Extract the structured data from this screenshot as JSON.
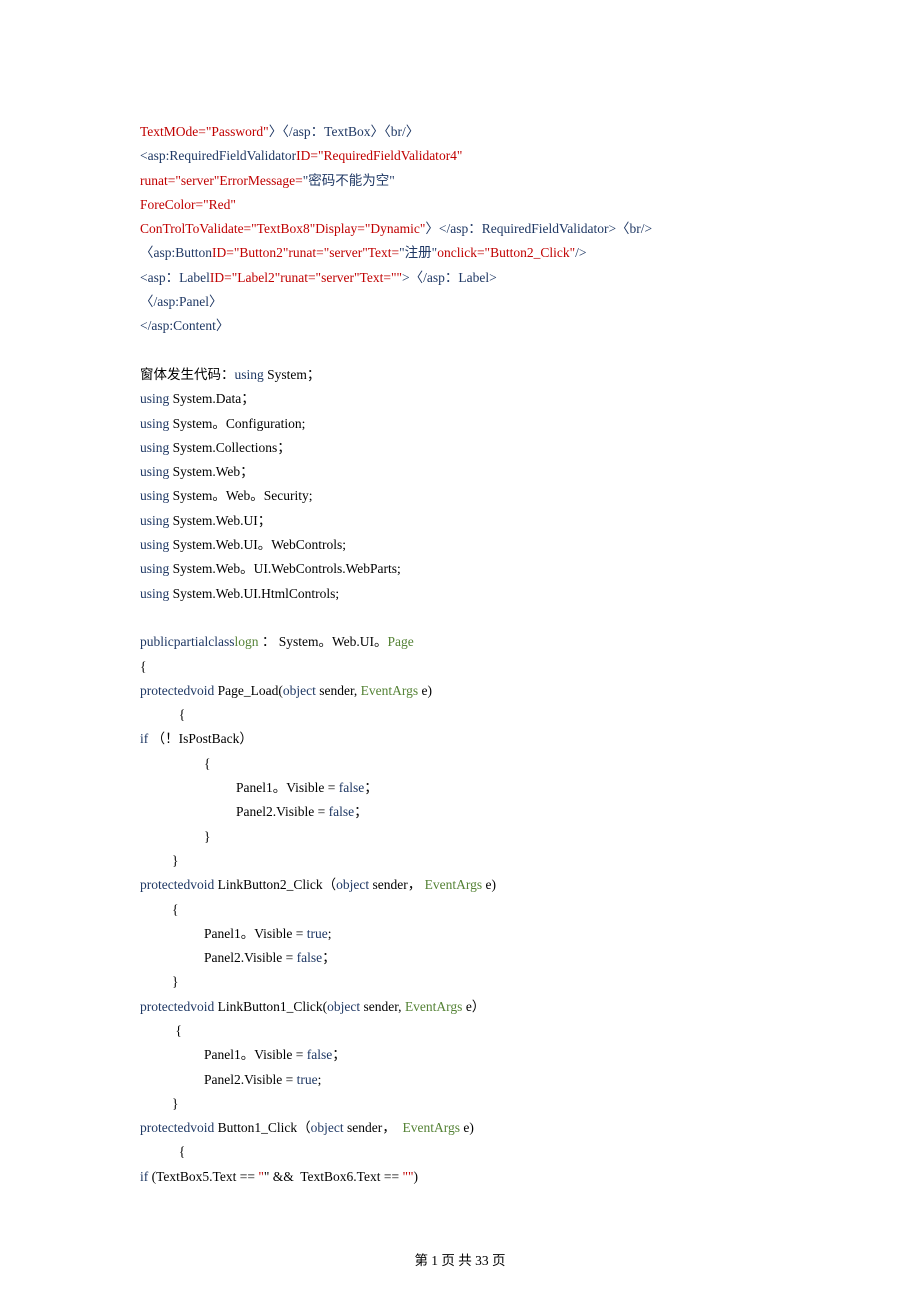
{
  "lines": [
    {
      "cls": "line",
      "segs": [
        {
          "c": "red",
          "t": "TextMOde=\"Password\""
        },
        {
          "c": "navy",
          "t": "〉〈/asp：TextBox〉〈br/〉"
        }
      ]
    },
    {
      "cls": "line",
      "segs": [
        {
          "c": "navy",
          "t": "<asp:RequiredFieldValidator"
        },
        {
          "c": "red",
          "t": "ID=\"RequiredFieldValidator4\""
        }
      ]
    },
    {
      "cls": "line",
      "segs": [
        {
          "c": "red",
          "t": "runat=\"server\""
        },
        {
          "c": "red",
          "t": "ErrorMessage="
        },
        {
          "c": "navy",
          "t": "\"密码不能为空\""
        }
      ]
    },
    {
      "cls": "line",
      "segs": [
        {
          "c": "red",
          "t": "ForeColor=\"Red\""
        }
      ]
    },
    {
      "cls": "line",
      "segs": [
        {
          "c": "red",
          "t": "ConTrolToValidate=\"TextBox8\"Display=\"Dynamic\""
        },
        {
          "c": "navy",
          "t": "〉</asp：RequiredFieldValidator>〈br/>"
        }
      ]
    },
    {
      "cls": "line",
      "segs": [
        {
          "c": "navy",
          "t": "〈asp:Button"
        },
        {
          "c": "red",
          "t": "ID=\"Button2\"runat=\"server\"Text="
        },
        {
          "c": "navy",
          "t": "\"注册\""
        },
        {
          "c": "red",
          "t": "onclick=\"Button2_Click\""
        },
        {
          "c": "navy",
          "t": "/>"
        }
      ]
    },
    {
      "cls": "line",
      "segs": [
        {
          "c": "navy",
          "t": "<asp：Label"
        },
        {
          "c": "red",
          "t": "ID=\"Label2\"runat=\"server\"Text=\"\""
        },
        {
          "c": "navy",
          "t": ">〈/asp：Label>"
        }
      ]
    },
    {
      "cls": "line",
      "segs": [
        {
          "c": "navy",
          "t": "〈/asp:Panel〉"
        }
      ]
    },
    {
      "cls": "line",
      "segs": [
        {
          "c": "navy",
          "t": "</asp:Content〉"
        }
      ]
    },
    {
      "cls": "line",
      "segs": [
        {
          "c": "black",
          "t": " "
        }
      ]
    },
    {
      "cls": "line",
      "segs": [
        {
          "c": "black",
          "t": "窗体发生代码："
        },
        {
          "c": "navy",
          "t": "using"
        },
        {
          "c": "black",
          "t": " System；"
        }
      ]
    },
    {
      "cls": "line",
      "segs": [
        {
          "c": "navy",
          "t": "using"
        },
        {
          "c": "black",
          "t": " System.Data；"
        }
      ]
    },
    {
      "cls": "line",
      "segs": [
        {
          "c": "navy",
          "t": "using"
        },
        {
          "c": "black",
          "t": " System。Configuration;"
        }
      ]
    },
    {
      "cls": "line",
      "segs": [
        {
          "c": "navy",
          "t": "using"
        },
        {
          "c": "black",
          "t": " System.Collections；"
        }
      ]
    },
    {
      "cls": "line",
      "segs": [
        {
          "c": "navy",
          "t": "using"
        },
        {
          "c": "black",
          "t": " System.Web；"
        }
      ]
    },
    {
      "cls": "line",
      "segs": [
        {
          "c": "navy",
          "t": "using"
        },
        {
          "c": "black",
          "t": " System。Web。Security;"
        }
      ]
    },
    {
      "cls": "line",
      "segs": [
        {
          "c": "navy",
          "t": "using"
        },
        {
          "c": "black",
          "t": " System.Web.UI；"
        }
      ]
    },
    {
      "cls": "line",
      "segs": [
        {
          "c": "navy",
          "t": "using"
        },
        {
          "c": "black",
          "t": " System.Web.UI。WebControls;"
        }
      ]
    },
    {
      "cls": "line",
      "segs": [
        {
          "c": "navy",
          "t": "using"
        },
        {
          "c": "black",
          "t": " System.Web。UI.WebControls.WebParts;"
        }
      ]
    },
    {
      "cls": "line",
      "segs": [
        {
          "c": "navy",
          "t": "using"
        },
        {
          "c": "black",
          "t": " System.Web.UI.HtmlControls;"
        }
      ]
    },
    {
      "cls": "line",
      "segs": [
        {
          "c": "black",
          "t": " "
        }
      ]
    },
    {
      "cls": "line",
      "segs": [
        {
          "c": "navy",
          "t": "publicpartialclass"
        },
        {
          "c": "green",
          "t": "logn"
        },
        {
          "c": "black",
          "t": " ： System。Web.UI。"
        },
        {
          "c": "green",
          "t": "Page"
        }
      ]
    },
    {
      "cls": "line",
      "segs": [
        {
          "c": "black",
          "t": "{"
        }
      ]
    },
    {
      "cls": "line",
      "segs": [
        {
          "c": "navy",
          "t": "protectedvoid"
        },
        {
          "c": "black",
          "t": " Page_Load("
        },
        {
          "c": "navy",
          "t": "object"
        },
        {
          "c": "black",
          "t": " sender, "
        },
        {
          "c": "green",
          "t": "EventArgs"
        },
        {
          "c": "black",
          "t": " e)"
        }
      ]
    },
    {
      "cls": "line ind1",
      "segs": [
        {
          "c": "black",
          "t": "  {"
        }
      ]
    },
    {
      "cls": "line",
      "segs": [
        {
          "c": "navy",
          "t": "if"
        },
        {
          "c": "black",
          "t": " （！IsPostBack）"
        }
      ]
    },
    {
      "cls": "line ind2",
      "segs": [
        {
          "c": "black",
          "t": "{"
        }
      ]
    },
    {
      "cls": "line ind3",
      "segs": [
        {
          "c": "black",
          "t": "Panel1。Visible = "
        },
        {
          "c": "navy",
          "t": "false"
        },
        {
          "c": "black",
          "t": "；"
        }
      ]
    },
    {
      "cls": "line ind3",
      "segs": [
        {
          "c": "black",
          "t": "Panel2.Visible = "
        },
        {
          "c": "navy",
          "t": "false"
        },
        {
          "c": "black",
          "t": "；"
        }
      ]
    },
    {
      "cls": "line ind2",
      "segs": [
        {
          "c": "black",
          "t": "}"
        }
      ]
    },
    {
      "cls": "line ind1",
      "segs": [
        {
          "c": "black",
          "t": "}"
        }
      ]
    },
    {
      "cls": "line",
      "segs": [
        {
          "c": "navy",
          "t": "protectedvoid"
        },
        {
          "c": "black",
          "t": " LinkButton2_Click（"
        },
        {
          "c": "navy",
          "t": "object"
        },
        {
          "c": "black",
          "t": " sender， "
        },
        {
          "c": "green",
          "t": "EventArgs"
        },
        {
          "c": "black",
          "t": " e)"
        }
      ]
    },
    {
      "cls": "line ind1",
      "segs": [
        {
          "c": "black",
          "t": "{"
        }
      ]
    },
    {
      "cls": "line ind2",
      "segs": [
        {
          "c": "black",
          "t": "Panel1。Visible = "
        },
        {
          "c": "navy",
          "t": "true"
        },
        {
          "c": "black",
          "t": ";"
        }
      ]
    },
    {
      "cls": "line ind2",
      "segs": [
        {
          "c": "black",
          "t": "Panel2.Visible = "
        },
        {
          "c": "navy",
          "t": "false"
        },
        {
          "c": "black",
          "t": "；"
        }
      ]
    },
    {
      "cls": "line ind1",
      "segs": [
        {
          "c": "black",
          "t": "}"
        }
      ]
    },
    {
      "cls": "line",
      "segs": [
        {
          "c": "navy",
          "t": "protectedvoid"
        },
        {
          "c": "black",
          "t": " LinkButton1_Click("
        },
        {
          "c": "navy",
          "t": "object"
        },
        {
          "c": "black",
          "t": " sender, "
        },
        {
          "c": "green",
          "t": "EventArgs"
        },
        {
          "c": "black",
          "t": " e）"
        }
      ]
    },
    {
      "cls": "line ind1",
      "segs": [
        {
          "c": "black",
          "t": " {"
        }
      ]
    },
    {
      "cls": "line ind2",
      "segs": [
        {
          "c": "black",
          "t": "Panel1。Visible = "
        },
        {
          "c": "navy",
          "t": "false"
        },
        {
          "c": "black",
          "t": "；"
        }
      ]
    },
    {
      "cls": "line ind2",
      "segs": [
        {
          "c": "black",
          "t": "Panel2.Visible = "
        },
        {
          "c": "navy",
          "t": "true"
        },
        {
          "c": "black",
          "t": ";"
        }
      ]
    },
    {
      "cls": "line ind1",
      "segs": [
        {
          "c": "black",
          "t": "}"
        }
      ]
    },
    {
      "cls": "line",
      "segs": [
        {
          "c": "navy",
          "t": "protectedvoid"
        },
        {
          "c": "black",
          "t": " Button1_Click（"
        },
        {
          "c": "navy",
          "t": "object"
        },
        {
          "c": "black",
          "t": " sender，  "
        },
        {
          "c": "green",
          "t": "EventArgs"
        },
        {
          "c": "black",
          "t": " e)"
        }
      ]
    },
    {
      "cls": "line ind1",
      "segs": [
        {
          "c": "black",
          "t": "  {"
        }
      ]
    },
    {
      "cls": "line",
      "segs": [
        {
          "c": "navy",
          "t": "if"
        },
        {
          "c": "black",
          "t": " (TextBox5.Text == "
        },
        {
          "c": "red",
          "t": "\""
        },
        {
          "c": "black",
          "t": "\" &&  TextBox6.Text == "
        },
        {
          "c": "red",
          "t": "\"\""
        },
        {
          "c": "black",
          "t": ")"
        }
      ]
    }
  ],
  "footer": "第 1 页 共 33 页"
}
